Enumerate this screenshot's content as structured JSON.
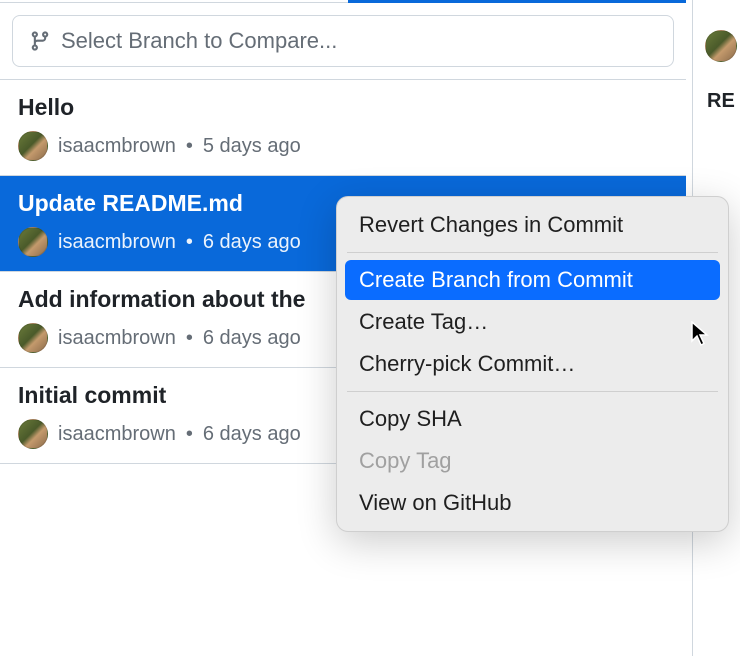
{
  "branchSelector": {
    "placeholder": "Select Branch to Compare..."
  },
  "commits": [
    {
      "title": "Hello",
      "author": "isaacmbrown",
      "time": "5 days ago",
      "selected": false
    },
    {
      "title": "Update README.md",
      "author": "isaacmbrown",
      "time": "6 days ago",
      "selected": true
    },
    {
      "title": "Add information about the",
      "author": "isaacmbrown",
      "time": "6 days ago",
      "selected": false
    },
    {
      "title": "Initial commit",
      "author": "isaacmbrown",
      "time": "6 days ago",
      "selected": false
    }
  ],
  "contextMenu": {
    "items": [
      {
        "label": "Revert Changes in Commit",
        "highlighted": false,
        "disabled": false
      },
      {
        "separator": true
      },
      {
        "label": "Create Branch from Commit",
        "highlighted": true,
        "disabled": false
      },
      {
        "label": "Create Tag…",
        "highlighted": false,
        "disabled": false
      },
      {
        "label": "Cherry-pick Commit…",
        "highlighted": false,
        "disabled": false
      },
      {
        "separator": true
      },
      {
        "label": "Copy SHA",
        "highlighted": false,
        "disabled": false
      },
      {
        "label": "Copy Tag",
        "highlighted": false,
        "disabled": true
      },
      {
        "label": "View on GitHub",
        "highlighted": false,
        "disabled": false
      }
    ]
  },
  "rightPanel": {
    "label": "RE"
  },
  "meta": {
    "dot": "•"
  }
}
